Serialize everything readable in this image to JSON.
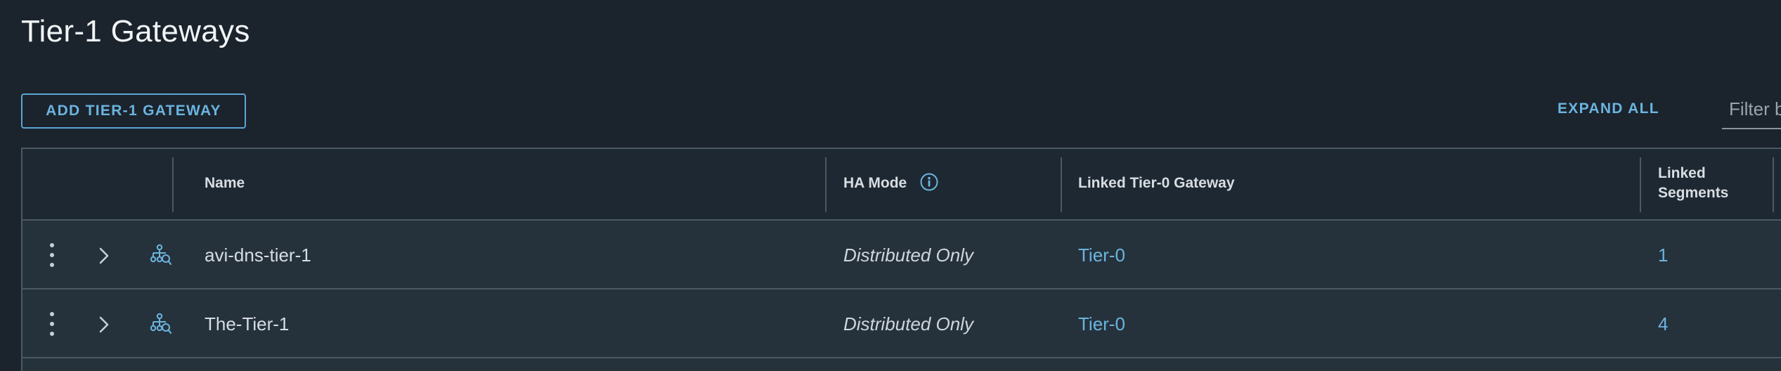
{
  "page": {
    "title": "Tier-1 Gateways"
  },
  "toolbar": {
    "add_label": "ADD TIER-1 GATEWAY",
    "expand_all_label": "EXPAND ALL",
    "filter_placeholder": "Filter by Name, Path and more"
  },
  "table": {
    "headers": {
      "name": "Name",
      "ha_mode": "HA Mode",
      "linked_tier0": "Linked Tier-0 Gateway",
      "linked_segments_line1": "Linked",
      "linked_segments_line2": "Segments"
    },
    "rows": [
      {
        "name": "avi-dns-tier-1",
        "ha_mode": "Distributed Only",
        "linked_tier0": "Tier-0",
        "linked_segments": "1"
      },
      {
        "name": "The-Tier-1",
        "ha_mode": "Distributed Only",
        "linked_tier0": "Tier-0",
        "linked_segments": "4"
      }
    ]
  },
  "icons": {
    "row_actions": "kebab-vertical-icon",
    "expand": "chevron-right-icon",
    "gateway": "tier1-gateway-icon",
    "info": "info-circle-icon"
  },
  "colors": {
    "background": "#1b232c",
    "accent": "#6bb4df",
    "border": "#4b5963",
    "row": "#25323c"
  }
}
